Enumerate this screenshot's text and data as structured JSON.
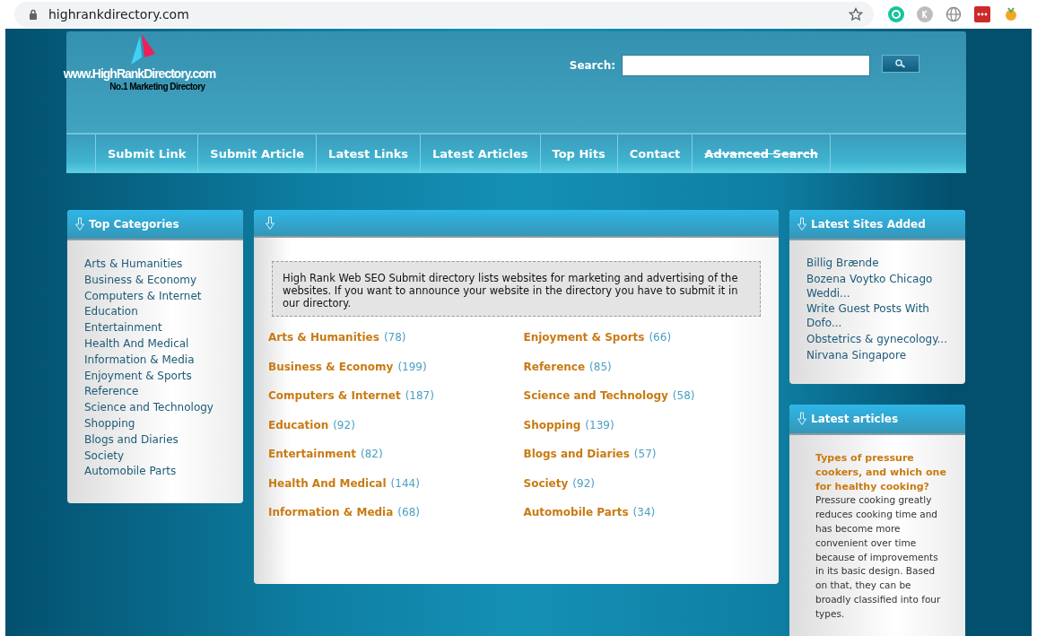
{
  "browser": {
    "url": "highrankdirectory.com"
  },
  "logo": {
    "title": "www.HighRankDirectory.com",
    "tagline": "No.1 Marketing Directory"
  },
  "search": {
    "label": "Search:"
  },
  "nav": [
    {
      "label": "Submit Link",
      "struck": false
    },
    {
      "label": "Submit Article",
      "struck": false
    },
    {
      "label": "Latest Links",
      "struck": false
    },
    {
      "label": "Latest Articles",
      "struck": false
    },
    {
      "label": "Top Hits",
      "struck": false
    },
    {
      "label": "Contact",
      "struck": false
    },
    {
      "label": "Advanced Search",
      "struck": true
    }
  ],
  "top_categories": {
    "title": "Top Categories",
    "items": [
      "Arts & Humanities",
      "Business & Economy",
      "Computers & Internet",
      "Education",
      "Entertainment",
      "Health And Medical",
      "Information & Media",
      "Enjoyment & Sports",
      "Reference",
      "Science and Technology",
      "Shopping",
      "Blogs and Diaries",
      "Society",
      "Automobile Parts"
    ]
  },
  "main": {
    "intro": "High Rank Web SEO Submit directory lists websites for marketing and advertising of the websites. If you want to announce your website in the directory you have to submit it in our directory.",
    "categories": [
      {
        "name": "Arts & Humanities",
        "count": "(78)"
      },
      {
        "name": "Enjoyment & Sports",
        "count": "(66)"
      },
      {
        "name": "Business & Economy",
        "count": "(199)"
      },
      {
        "name": "Reference",
        "count": "(85)"
      },
      {
        "name": "Computers & Internet",
        "count": "(187)"
      },
      {
        "name": "Science and Technology",
        "count": "(58)"
      },
      {
        "name": "Education",
        "count": "(92)"
      },
      {
        "name": "Shopping",
        "count": "(139)"
      },
      {
        "name": "Entertainment",
        "count": "(82)"
      },
      {
        "name": "Blogs and Diaries",
        "count": "(57)"
      },
      {
        "name": "Health And Medical",
        "count": "(144)"
      },
      {
        "name": "Society",
        "count": "(92)"
      },
      {
        "name": "Information & Media",
        "count": "(68)"
      },
      {
        "name": "Automobile Parts",
        "count": "(34)"
      }
    ]
  },
  "latest_sites": {
    "title": "Latest Sites Added",
    "items": [
      "Billig Brænde",
      "Bozena Voytko Chicago Weddi...",
      "Write Guest Posts With Dofo...",
      "Obstetrics & gynecology...",
      "Nirvana Singapore"
    ]
  },
  "latest_articles": {
    "title": "Latest articles",
    "items": [
      {
        "title": "Types of pressure cookers, and which one for healthy cooking?",
        "summary": "Pressure cooking greatly reduces cooking time and has become more convenient over time because of improvements in its basic design. Based on that, they can be broadly classified into four types."
      }
    ]
  }
}
